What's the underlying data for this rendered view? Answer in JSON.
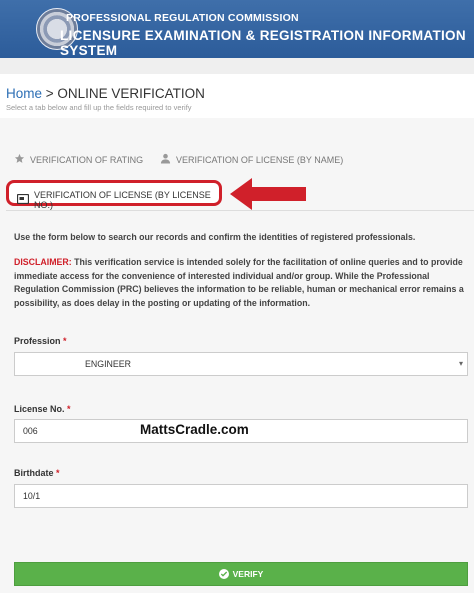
{
  "header": {
    "line1": "PROFESSIONAL REGULATION COMMISSION",
    "line2": "LICENSURE EXAMINATION & REGISTRATION INFORMATION SYSTEM"
  },
  "breadcrumb": {
    "home": "Home",
    "separator": " > ",
    "current": "ONLINE VERIFICATION",
    "subtitle": "Select a tab below and fill up the fields required to verify"
  },
  "tabs": [
    {
      "label": "VERIFICATION OF RATING",
      "icon": "star-icon",
      "active": false
    },
    {
      "label": "VERIFICATION OF LICENSE (BY NAME)",
      "icon": "person-icon",
      "active": false
    },
    {
      "label": "VERIFICATION OF LICENSE (BY LICENSE NO.)",
      "icon": "id-card-icon",
      "active": true
    }
  ],
  "intro": "Use the form below to search our records and confirm the identities of registered professionals.",
  "disclaimer": {
    "heading": "DISCLAIMER:",
    "text": " This verification service is intended solely for the facilitation of online queries and to provide immediate access for the convenience of interested individual and/or group. While the Professional Regulation Commission (PRC) believes the information to be reliable, human or mechanical error remains a possibility, as does delay in the posting or updating of the information."
  },
  "form": {
    "profession_label": "Profession",
    "profession_value": "ENGINEER",
    "license_label": "License No.",
    "license_value": "006",
    "birthdate_label": "Birthdate",
    "birthdate_value": "10/1",
    "required_mark": " *"
  },
  "watermark": "MattsCradle.com",
  "verify_label": "VERIFY",
  "colors": {
    "header_bg": "#3f6faa",
    "accent_red": "#d0202a",
    "link_blue": "#2d6fb5",
    "verify_green": "#5ab14a"
  }
}
